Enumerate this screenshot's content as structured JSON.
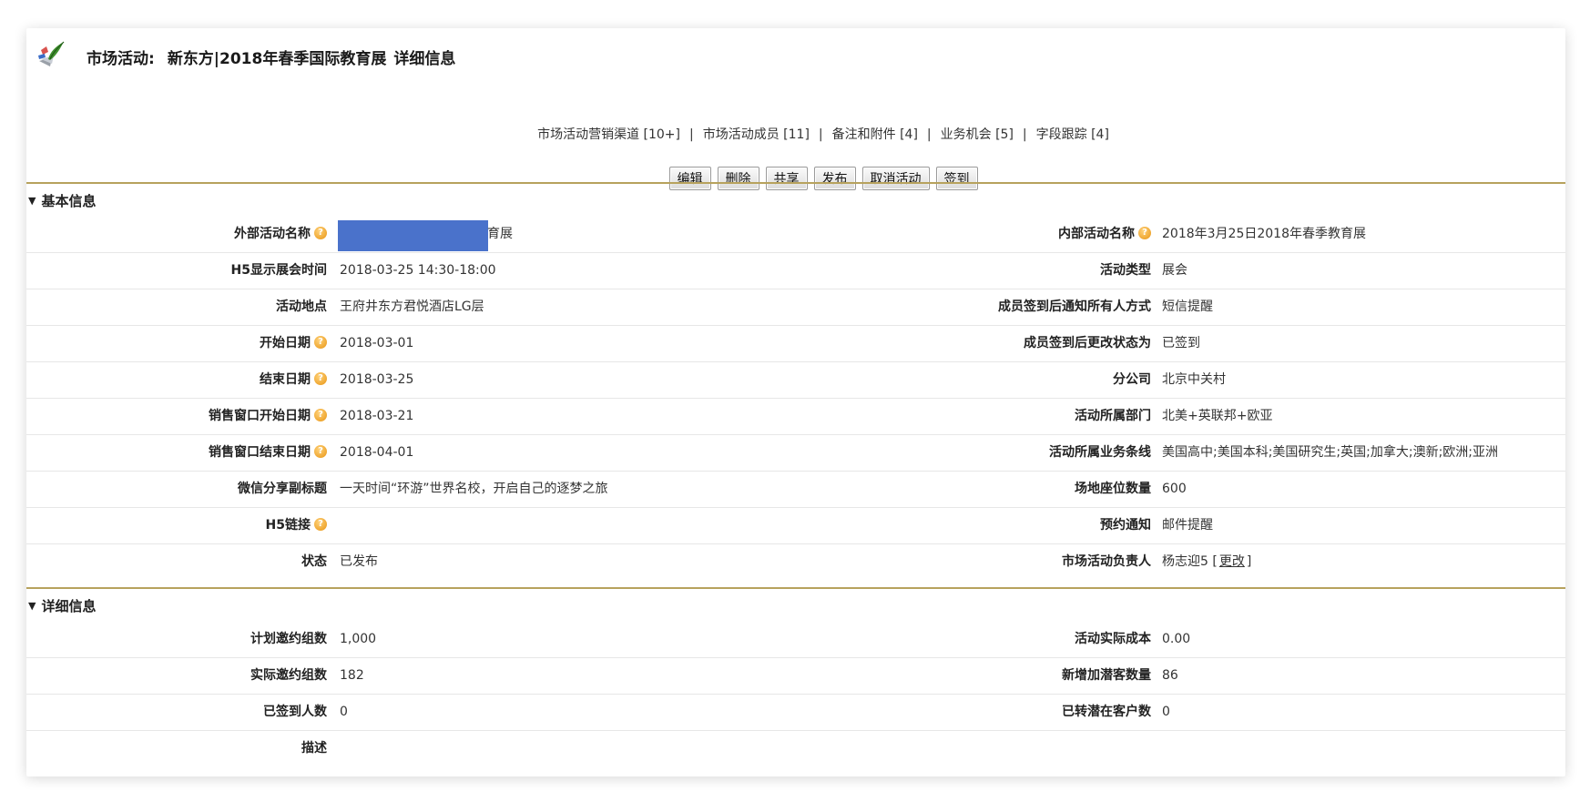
{
  "title": {
    "prefix": "市场活动:",
    "name": "新东方|2018年春季国际教育展",
    "suffix": "详细信息"
  },
  "links": [
    "市场活动营销渠道 [10+]",
    "市场活动成员 [11]",
    "备注和附件 [4]",
    "业务机会 [5]",
    "字段跟踪 [4]"
  ],
  "link_separator": "|",
  "buttons": [
    "编辑",
    "删除",
    "共享",
    "发布",
    "取消活动",
    "签到"
  ],
  "basic": {
    "heading": "基本信息",
    "rows": [
      {
        "l_label": "外部活动名称",
        "l_help": true,
        "l_value": "育展",
        "r_label": "内部活动名称",
        "r_help": true,
        "r_value": "2018年3月25日2018年春季教育展"
      },
      {
        "l_label": "H5显示展会时间",
        "l_help": false,
        "l_value": "2018-03-25 14:30-18:00",
        "r_label": "活动类型",
        "r_help": false,
        "r_value": "展会"
      },
      {
        "l_label": "活动地点",
        "l_help": false,
        "l_value": "王府井东方君悦酒店LG层",
        "r_label": "成员签到后通知所有人方式",
        "r_help": false,
        "r_value": "短信提醒"
      },
      {
        "l_label": "开始日期",
        "l_help": true,
        "l_value": "2018-03-01",
        "r_label": "成员签到后更改状态为",
        "r_help": false,
        "r_value": "已签到"
      },
      {
        "l_label": "结束日期",
        "l_help": true,
        "l_value": "2018-03-25",
        "r_label": "分公司",
        "r_help": false,
        "r_value": "北京中关村"
      },
      {
        "l_label": "销售窗口开始日期",
        "l_help": true,
        "l_value": "2018-03-21",
        "r_label": "活动所属部门",
        "r_help": false,
        "r_value": "北美+英联邦+欧亚"
      },
      {
        "l_label": "销售窗口结束日期",
        "l_help": true,
        "l_value": "2018-04-01",
        "r_label": "活动所属业务条线",
        "r_help": false,
        "r_value": "美国高中;美国本科;美国研究生;英国;加拿大;澳新;欧洲;亚洲"
      },
      {
        "l_label": "微信分享副标题",
        "l_help": false,
        "l_value": "一天时间“环游”世界名校，开启自己的逐梦之旅",
        "r_label": "场地座位数量",
        "r_help": false,
        "r_value": "600"
      },
      {
        "l_label": "H5链接",
        "l_help": true,
        "l_value": "",
        "r_label": "预约通知",
        "r_help": false,
        "r_value": "邮件提醒"
      },
      {
        "l_label": "状态",
        "l_help": false,
        "l_value": "已发布",
        "r_label": "市场活动负责人",
        "r_help": false,
        "r_value": "杨志迎5"
      }
    ],
    "owner_change": {
      "open": "[",
      "link": "更改",
      "close": "]"
    }
  },
  "detail": {
    "heading": "详细信息",
    "rows": [
      {
        "l_label": "计划邀约组数",
        "l_value": "1,000",
        "r_label": "活动实际成本",
        "r_value": "0.00"
      },
      {
        "l_label": "实际邀约组数",
        "l_value": "182",
        "r_label": "新增加潜客数量",
        "r_value": "86"
      },
      {
        "l_label": "已签到人数",
        "l_value": "0",
        "r_label": "已转潜在客户数",
        "r_value": "0"
      },
      {
        "l_label": "描述",
        "l_value": "",
        "r_label": "",
        "r_value": ""
      }
    ]
  },
  "help_glyph": "?",
  "triangle_glyph": "▼",
  "colors": {
    "section_border": "#b7a25d",
    "redaction": "#4a72cb",
    "help_icon": "#e89412"
  },
  "icons": [
    "campaign-quill-icon",
    "help-icon",
    "collapse-triangle-icon"
  ]
}
